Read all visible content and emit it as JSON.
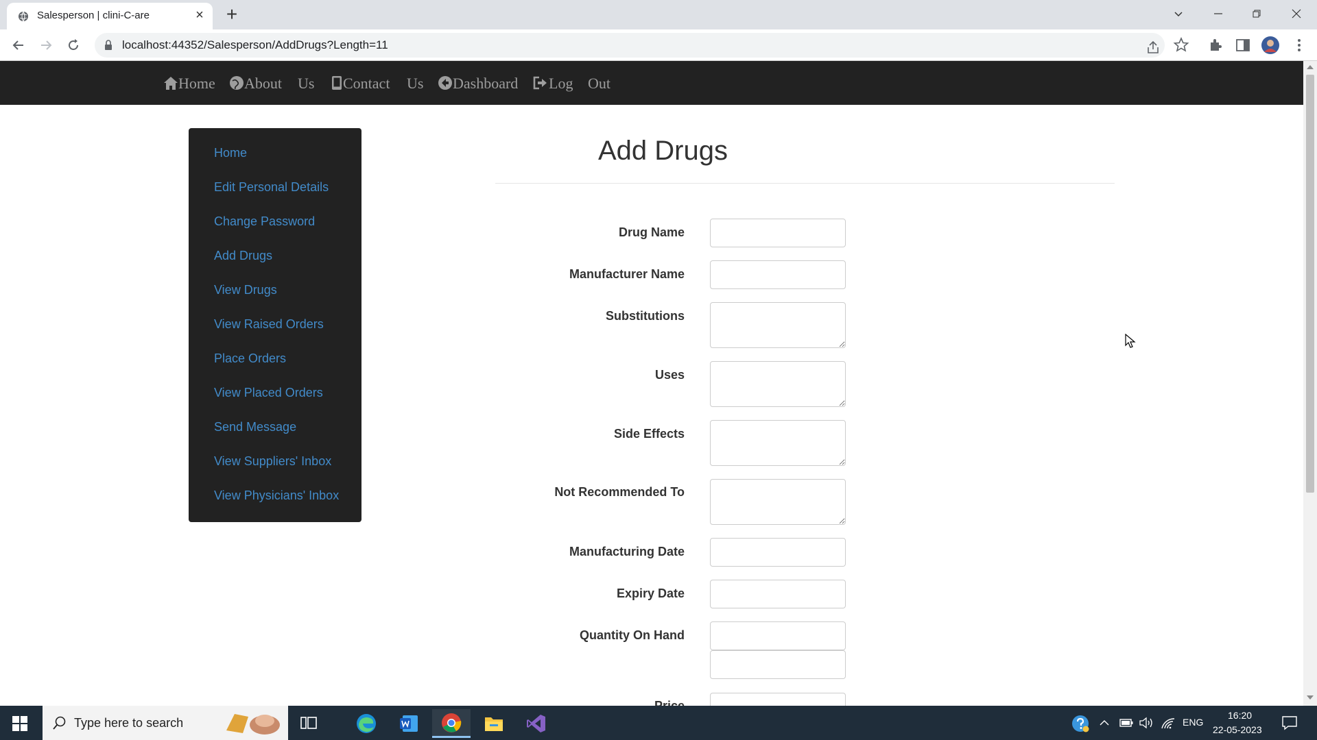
{
  "browser": {
    "tab_title": "Salesperson | clini-C-are",
    "url": "localhost:44352/Salesperson/AddDrugs?Length=11",
    "new_tab": "+",
    "close_tab": "×",
    "window_controls": [
      "chevron-down-icon",
      "minimize-icon",
      "maximize-icon",
      "close-icon"
    ]
  },
  "navbar": {
    "items": [
      {
        "icon": "home-icon",
        "label": "Home"
      },
      {
        "icon": "globe-icon",
        "label": "About"
      },
      {
        "label": "Us"
      },
      {
        "icon": "phone-icon",
        "label": "Contact"
      },
      {
        "label": "Us"
      },
      {
        "icon": "arrow-circle-icon",
        "label": "Dashboard"
      },
      {
        "icon": "logout-icon",
        "label": "Log"
      },
      {
        "label": "Out"
      }
    ]
  },
  "sidebar": {
    "items": [
      "Home",
      "Edit Personal Details",
      "Change Password",
      "Add Drugs",
      "View Drugs",
      "View Raised Orders",
      "Place Orders",
      "View Placed Orders",
      "Send Message",
      "View Suppliers' Inbox",
      "View Physicians' Inbox"
    ]
  },
  "main": {
    "title": "Add Drugs",
    "fields": [
      {
        "label": "Drug Name",
        "type": "input",
        "value": ""
      },
      {
        "label": "Manufacturer Name",
        "type": "input",
        "value": ""
      },
      {
        "label": "Substitutions",
        "type": "textarea",
        "value": ""
      },
      {
        "label": "Uses",
        "type": "textarea",
        "value": ""
      },
      {
        "label": "Side Effects",
        "type": "textarea",
        "value": ""
      },
      {
        "label": "Not Recommended To",
        "type": "textarea",
        "value": ""
      },
      {
        "label": "Manufacturing Date",
        "type": "input",
        "value": ""
      },
      {
        "label": "Expiry Date",
        "type": "input",
        "value": ""
      },
      {
        "label": "Quantity On Hand",
        "type": "input",
        "value": ""
      },
      {
        "label": "",
        "type": "input",
        "value": ""
      },
      {
        "label": "Price",
        "type": "input",
        "value": ""
      }
    ]
  },
  "taskbar": {
    "search_placeholder": "Type here to search",
    "apps": [
      "windows-start-icon",
      "task-view-icon",
      "edge-icon",
      "word-icon",
      "chrome-icon",
      "file-explorer-icon",
      "visual-studio-icon"
    ],
    "language": "ENG",
    "time": "16:20",
    "date": "22-05-2023"
  },
  "colors": {
    "navbar_bg": "#222222",
    "nav_text": "#9d9d9d",
    "sidebar_bg": "#222222",
    "link": "#428bca",
    "taskbar_bg": "#1f2d3a"
  }
}
